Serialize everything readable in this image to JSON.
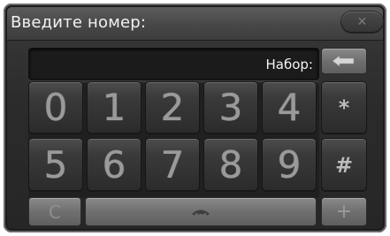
{
  "dialog": {
    "title": "Введите номер:",
    "close_icon": "close-x-icon"
  },
  "display": {
    "label": "Набор:",
    "value": ""
  },
  "keypad": {
    "row1": [
      "0",
      "1",
      "2",
      "3",
      "4"
    ],
    "row2": [
      "5",
      "6",
      "7",
      "8",
      "9"
    ],
    "star": "*",
    "hash": "#"
  },
  "controls": {
    "backspace_icon": "backspace-arrow-icon",
    "clear_label": "C",
    "call_icon": "phone-handset-icon",
    "plus_label": "+"
  },
  "colors": {
    "panel": "#2b2b2b",
    "key_text": "#9a9a9a",
    "light_button": "#6f6f6f"
  }
}
